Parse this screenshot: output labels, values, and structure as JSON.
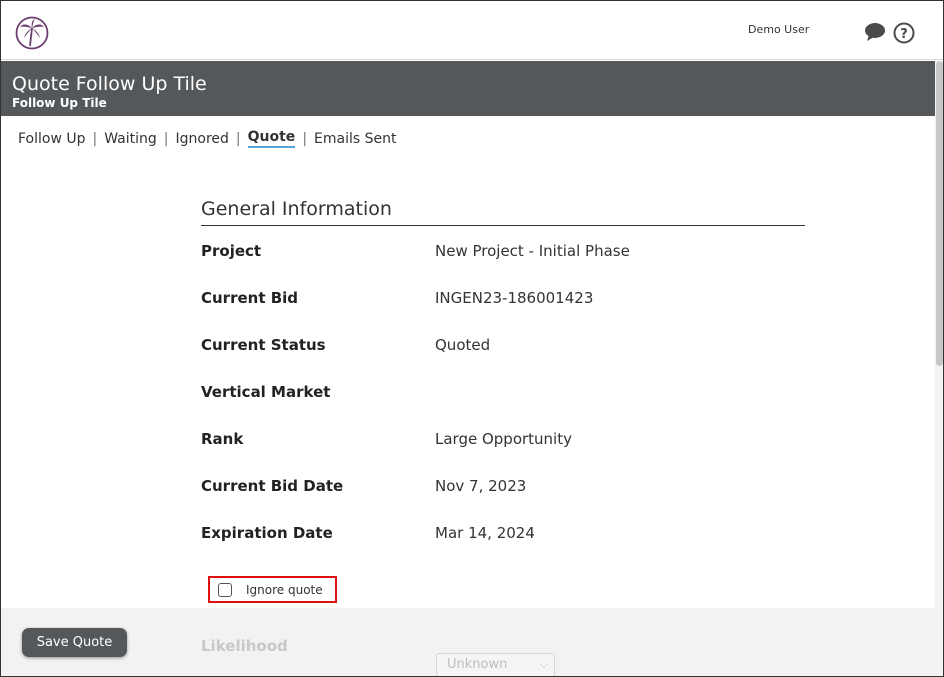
{
  "header": {
    "user_name": "Demo User",
    "icons": [
      "palm-logo",
      "chat-icon",
      "help-icon"
    ]
  },
  "titlebar": {
    "title": "Quote Follow Up Tile",
    "subtitle": "Follow Up Tile"
  },
  "tabs": [
    {
      "label": "Follow Up",
      "active": false
    },
    {
      "label": "Waiting",
      "active": false
    },
    {
      "label": "Ignored",
      "active": false
    },
    {
      "label": "Quote",
      "active": true
    },
    {
      "label": "Emails Sent",
      "active": false
    }
  ],
  "general": {
    "heading": "General Information",
    "rows": [
      {
        "label": "Project",
        "value": "New Project - Initial Phase"
      },
      {
        "label": "Current Bid",
        "value": "INGEN23-186001423"
      },
      {
        "label": "Current Status",
        "value": "Quoted"
      },
      {
        "label": "Vertical Market",
        "value": ""
      },
      {
        "label": "Rank",
        "value": "Large Opportunity"
      },
      {
        "label": "Current Bid Date",
        "value": "Nov 7, 2023"
      },
      {
        "label": "Expiration Date",
        "value": "Mar 14, 2024"
      }
    ]
  },
  "ignore": {
    "label": "Ignore quote",
    "checked": false
  },
  "likelihood": {
    "label": "Likelihood",
    "selected": "Unknown"
  },
  "actions": {
    "save_label": "Save Quote"
  },
  "colors": {
    "titlebar_bg": "#55585b",
    "logo_purple": "#6b3f6e",
    "active_tab_underline": "#5aa3d8",
    "highlight_border": "#dd1111"
  }
}
